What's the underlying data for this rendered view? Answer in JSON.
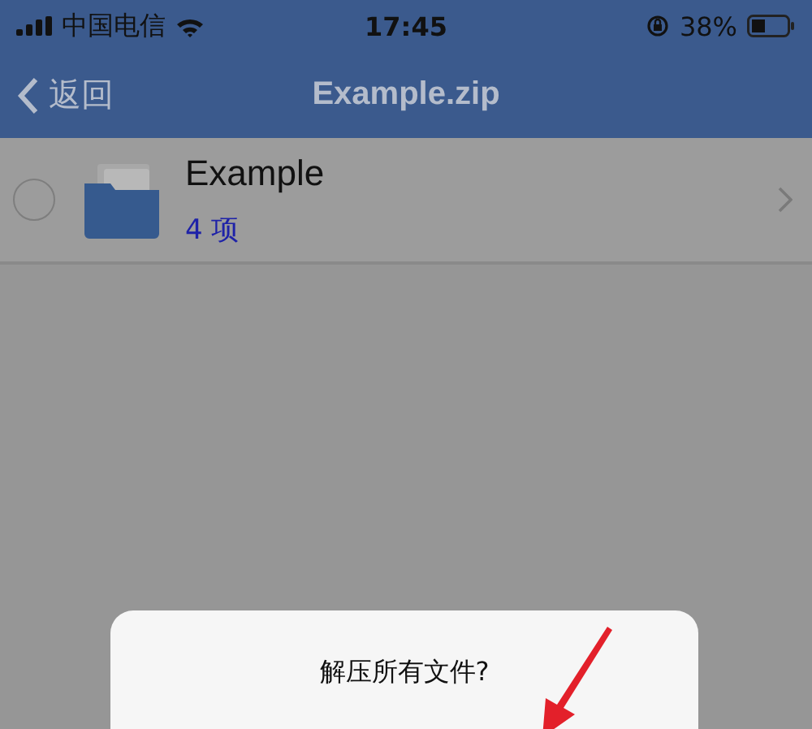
{
  "status_bar": {
    "carrier": "中国电信",
    "time": "17:45",
    "battery": "38%"
  },
  "nav": {
    "back": "返回",
    "title": "Example.zip"
  },
  "files": [
    {
      "name": "Example",
      "count": "4 项",
      "selected": false
    }
  ],
  "alert": {
    "message": "解压所有文件?"
  }
}
